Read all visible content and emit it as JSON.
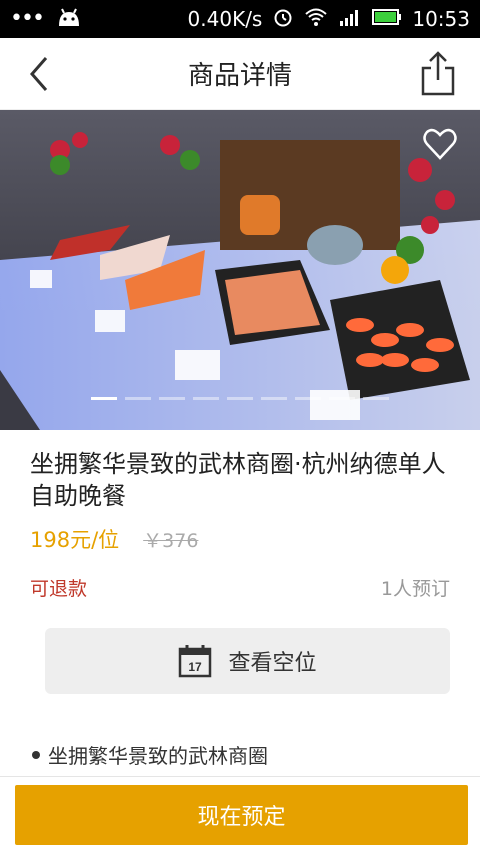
{
  "statusbar": {
    "net_speed": "0.40K/s",
    "time": "10:53"
  },
  "header": {
    "title": "商品详情"
  },
  "carousel": {
    "total": 9,
    "active_index": 0
  },
  "product": {
    "title": "坐拥繁华景致的武林商圈·杭州纳德单人自助晚餐",
    "price": "198元/位",
    "original_price": "￥376",
    "refund_label": "可退款",
    "booked_count": "1人预订",
    "check_button": "查看空位",
    "calendar_day": "17",
    "highlight": "坐拥繁华景致的武林商圈"
  },
  "footer": {
    "reserve_label": "现在预定"
  },
  "colors": {
    "accent": "#e6a100",
    "refund": "#c0392b"
  }
}
